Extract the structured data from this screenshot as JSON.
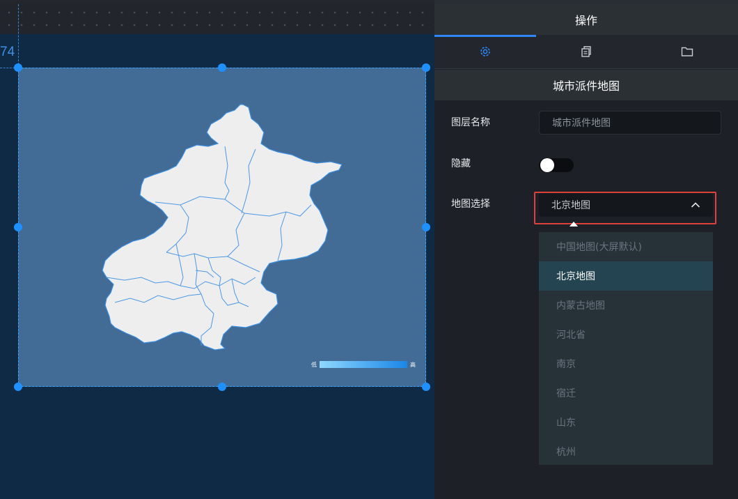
{
  "canvas": {
    "coordinate_label": "74",
    "legend": {
      "low_label": "低",
      "high_label": "高"
    }
  },
  "panel": {
    "header_title": "操作",
    "tabs": [
      {
        "icon": "gear-icon",
        "active": true
      },
      {
        "icon": "copy-icon",
        "active": false
      },
      {
        "icon": "folder-icon",
        "active": false
      }
    ],
    "section_title": "城市派件地图",
    "fields": {
      "layer_name_label": "图层名称",
      "layer_name_value": "城市派件地图",
      "hidden_label": "隐藏",
      "hidden_on": false,
      "map_select_label": "地图选择",
      "map_select_value": "北京地图"
    },
    "dropdown_options": [
      {
        "label": "中国地图(大屏默认)",
        "selected": false
      },
      {
        "label": "北京地图",
        "selected": true
      },
      {
        "label": "内蒙古地图",
        "selected": false
      },
      {
        "label": "河北省",
        "selected": false
      },
      {
        "label": "南京",
        "selected": false
      },
      {
        "label": "宿迁",
        "selected": false
      },
      {
        "label": "山东",
        "selected": false
      },
      {
        "label": "杭州",
        "selected": false
      }
    ]
  },
  "colors": {
    "accent": "#2f86f6",
    "highlight_border": "#e0403a",
    "map_fill": "#eeeeee",
    "map_border": "#3a8ee0"
  }
}
